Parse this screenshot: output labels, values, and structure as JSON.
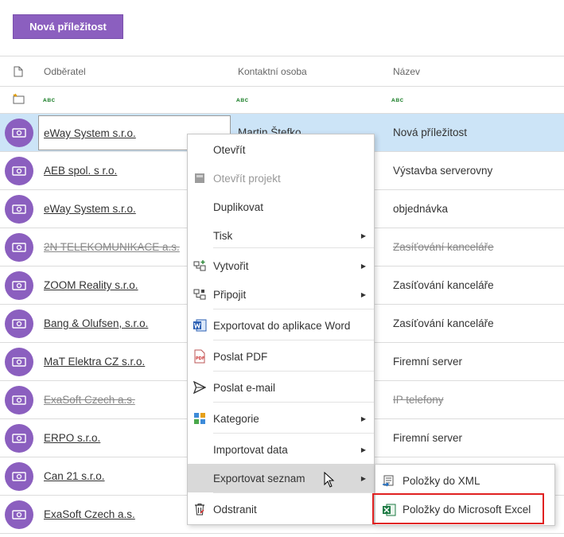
{
  "toolbar": {
    "new_label": "Nová příležitost"
  },
  "columns": {
    "customer": "Odběratel",
    "contact": "Kontaktní osoba",
    "name": "Název"
  },
  "filter_glyph": "ᴀʙᴄ",
  "rows": [
    {
      "customer": "eWay System s.r.o.",
      "contact": "Martin Štefko",
      "name": "Nová příležitost",
      "deleted": false,
      "selected": true
    },
    {
      "customer": "AEB spol. s r.o.",
      "contact": "",
      "name": "Výstavba serverovny",
      "deleted": false
    },
    {
      "customer": "eWay System s.r.o.",
      "contact": "",
      "name": "objednávka",
      "deleted": false
    },
    {
      "customer": "2N TELEKOMUNIKACE a.s.",
      "contact": "",
      "name": "Zasíťování kanceláře",
      "deleted": true
    },
    {
      "customer": "ZOOM Reality s.r.o.",
      "contact": "",
      "name": "Zasíťování kanceláře",
      "deleted": false
    },
    {
      "customer": "Bang & Olufsen, s.r.o.",
      "contact": "",
      "name": "Zasíťování kanceláře",
      "deleted": false
    },
    {
      "customer": "MaT Elektra CZ s.r.o.",
      "contact": "",
      "name": "Firemní server",
      "deleted": false
    },
    {
      "customer": "ExaSoft Czech a.s.",
      "contact": "",
      "name": "IP telefony",
      "deleted": true
    },
    {
      "customer": "ERPO s.r.o.",
      "contact": "",
      "name": "Firemní server",
      "deleted": false
    },
    {
      "customer": "Can 21 s.r.o.",
      "contact": "",
      "name": "",
      "deleted": false
    },
    {
      "customer": "ExaSoft Czech a.s.",
      "contact": "",
      "name": "",
      "deleted": false
    }
  ],
  "context_menu": [
    {
      "label": "Otevřít",
      "icon": "none"
    },
    {
      "label": "Otevřít projekt",
      "icon": "project-icon",
      "disabled": true
    },
    {
      "label": "Duplikovat",
      "icon": "none"
    },
    {
      "label": "Tisk",
      "icon": "none",
      "submenu": true
    },
    {
      "label": "Vytvořit",
      "icon": "create-icon",
      "submenu": true
    },
    {
      "label": "Připojit",
      "icon": "attach-icon",
      "submenu": true
    },
    {
      "label": "Exportovat do aplikace Word",
      "icon": "word-icon"
    },
    {
      "label": "Poslat PDF",
      "icon": "pdf-icon"
    },
    {
      "label": "Poslat e-mail",
      "icon": "send-icon"
    },
    {
      "label": "Kategorie",
      "icon": "category-icon",
      "submenu": true
    },
    {
      "label": "Importovat data",
      "icon": "none",
      "submenu": true
    },
    {
      "label": "Exportovat seznam",
      "icon": "none",
      "submenu": true,
      "hover": true
    },
    {
      "label": "Odstranit",
      "icon": "trash-icon"
    }
  ],
  "submenu": [
    {
      "label": "Položky do XML",
      "icon": "xml-export-icon"
    },
    {
      "label": "Položky do Microsoft Excel",
      "icon": "excel-icon"
    }
  ],
  "colors": {
    "accent": "#8b5fbf",
    "selected_row": "#cce4f7",
    "highlight": "#e02020"
  }
}
